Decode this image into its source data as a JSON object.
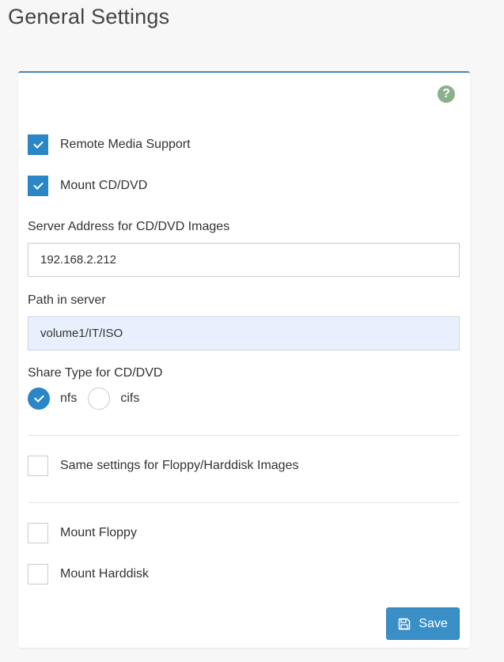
{
  "page": {
    "title": "General Settings"
  },
  "help": {
    "icon": "question-circle-icon",
    "glyph": "?"
  },
  "options": {
    "remote_media_support": {
      "label": "Remote Media Support",
      "checked": true
    },
    "mount_cd_dvd": {
      "label": "Mount CD/DVD",
      "checked": true
    },
    "same_settings": {
      "label": "Same settings for Floppy/Harddisk Images",
      "checked": false
    },
    "mount_floppy": {
      "label": "Mount Floppy",
      "checked": false
    },
    "mount_harddisk": {
      "label": "Mount Harddisk",
      "checked": false
    }
  },
  "server_address": {
    "label": "Server Address for CD/DVD Images",
    "value": "192.168.2.212"
  },
  "path": {
    "label": "Path in server",
    "value": "volume1/IT/ISO"
  },
  "share_type": {
    "label": "Share Type for CD/DVD",
    "options": [
      {
        "label": "nfs",
        "checked": true
      },
      {
        "label": "cifs",
        "checked": false
      }
    ]
  },
  "save_button": {
    "label": "Save",
    "icon": "floppy-disk-icon"
  },
  "colors": {
    "accent": "#2b86c8",
    "button": "#3a8fc6",
    "help": "#8cb08c",
    "autofill": "#e8f0fe"
  }
}
